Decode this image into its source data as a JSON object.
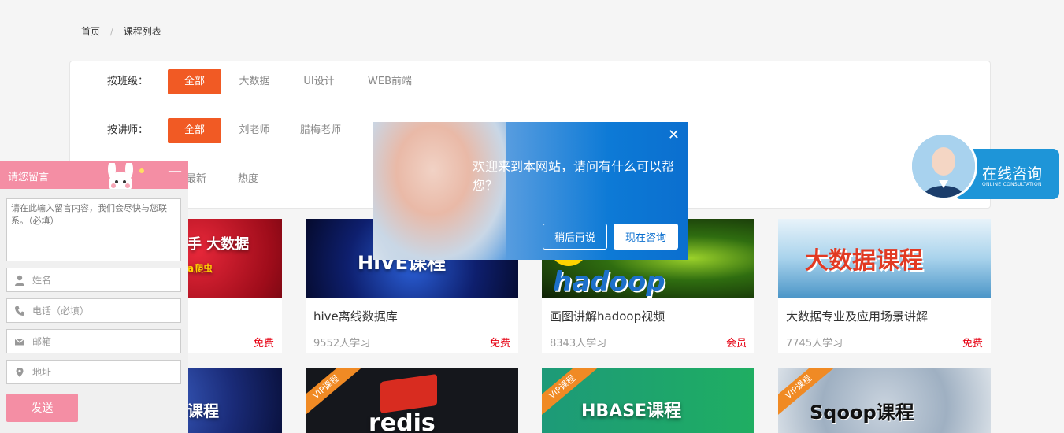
{
  "breadcrumb": {
    "home": "首页",
    "sep": "/",
    "current": "课程列表"
  },
  "filters": {
    "class_label": "按班级：",
    "class_options": [
      "全部",
      "大数据",
      "UI设计",
      "WEB前端"
    ],
    "teacher_label": "按讲师：",
    "teacher_options": [
      "全部",
      "刘老师",
      "腊梅老师"
    ],
    "sort_options": [
      "最新",
      "热度"
    ]
  },
  "courses_row1": [
    {
      "thumb_text": "手 大数据",
      "thumb_sub": "a爬虫",
      "title": "",
      "count": "",
      "price": "免费"
    },
    {
      "thumb_text": "HIVE课程",
      "title": "hive离线数据库",
      "count": "9552人学习",
      "price": "免费"
    },
    {
      "thumb_text": "hadoop",
      "title": "画图讲解hadoop视频",
      "count": "8343人学习",
      "price": "会员"
    },
    {
      "thumb_text": "大数据课程",
      "title": "大数据专业及应用场景讲解",
      "count": "7745人学习",
      "price": "免费"
    }
  ],
  "courses_row2": [
    {
      "vip": "",
      "thumb_text": "课程"
    },
    {
      "vip": "VIP课程",
      "thumb_text": "redis"
    },
    {
      "vip": "VIP课程",
      "thumb_text": "HBASE课程"
    },
    {
      "vip": "VIP课程",
      "thumb_text": "Sqoop课程"
    }
  ],
  "message_panel": {
    "title": "请您留言",
    "minimize": "—",
    "textarea_placeholder": "请在此输入留言内容，我们会尽快与您联系。（必填）",
    "name_placeholder": "姓名",
    "phone_placeholder": "电话（必填）",
    "email_placeholder": "邮箱",
    "address_placeholder": "地址",
    "send_label": "发送"
  },
  "popup": {
    "close": "✕",
    "message": "欢迎来到本网站，请问有什么可以帮您？",
    "later_label": "稍后再说",
    "now_label": "现在咨询"
  },
  "consult": {
    "title": "在线咨询",
    "subtitle": "ONLINE CONSULTATION"
  },
  "colors": {
    "accent": "#f15a24",
    "price": "#e60012",
    "pink": "#f48ea4",
    "blue": "#0b6fcf"
  }
}
